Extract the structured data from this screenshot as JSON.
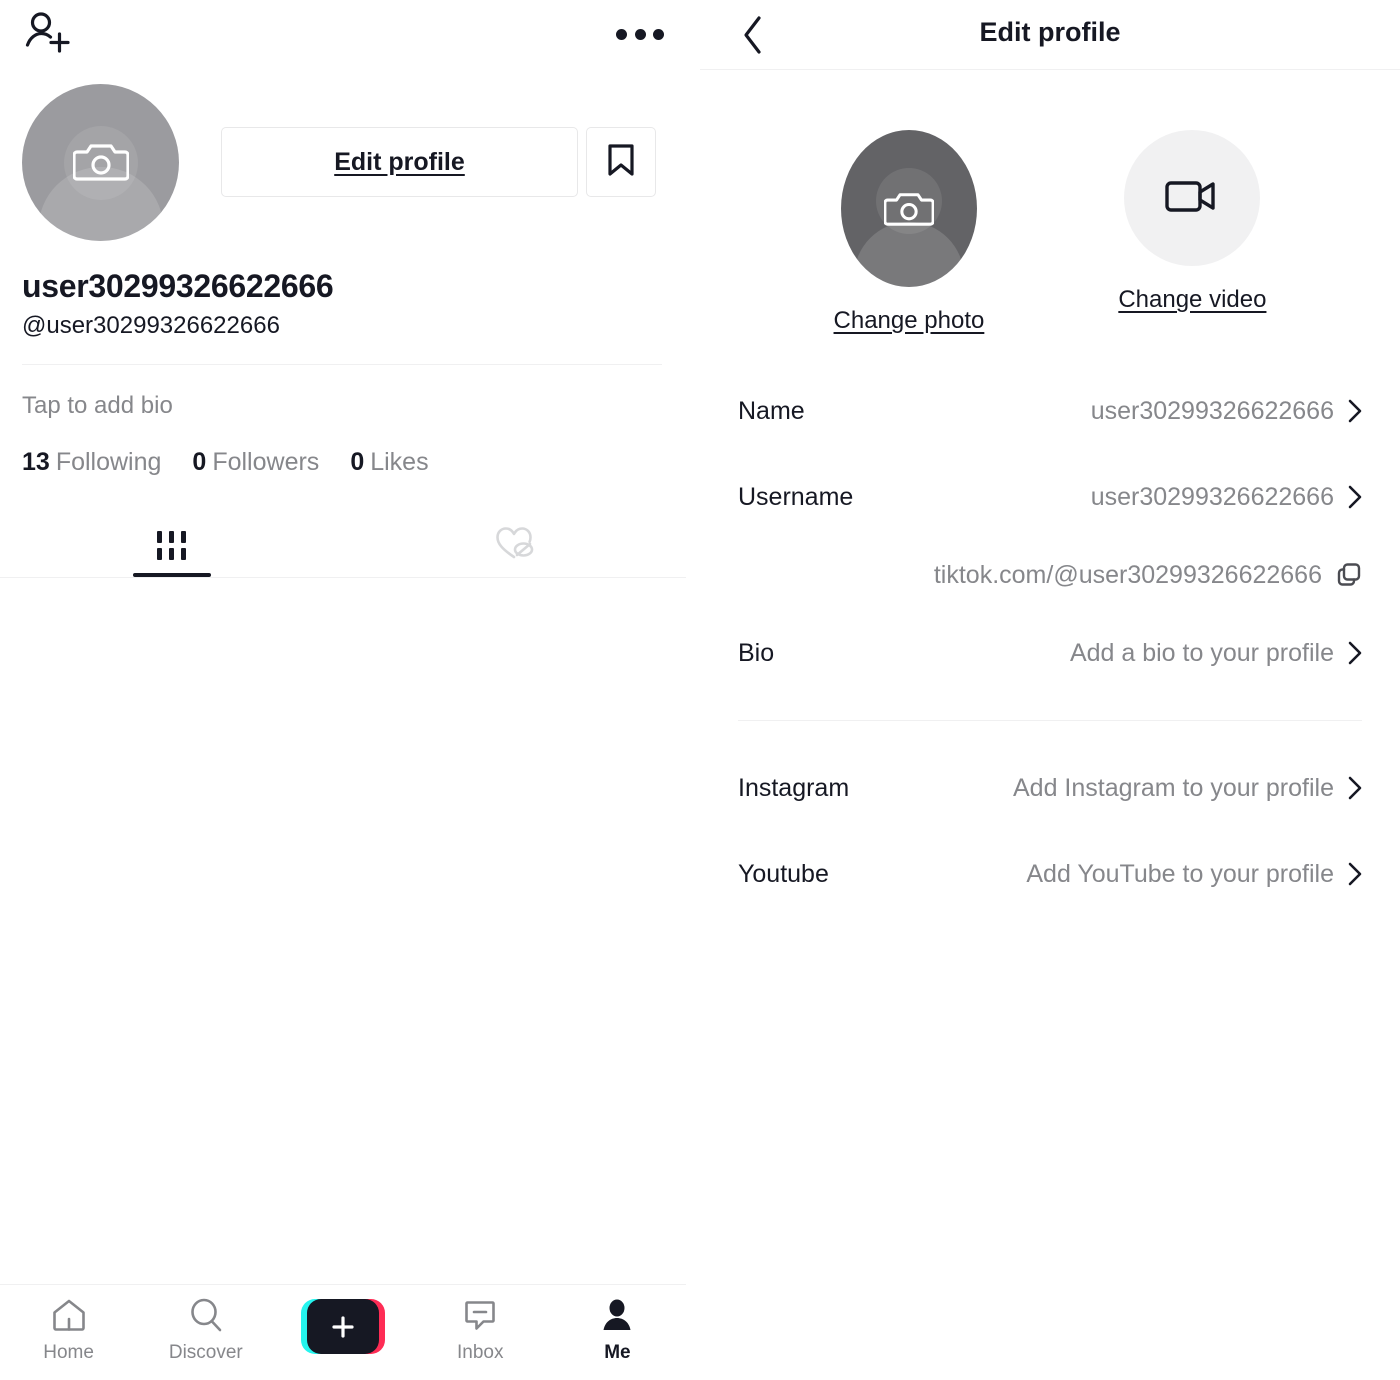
{
  "profile": {
    "topbar": {
      "add_user_icon": "person-add-icon",
      "more_icon": "more-options-icon"
    },
    "avatar_icon": "camera-icon",
    "edit_profile_label": "Edit profile",
    "bookmark_icon": "bookmark-icon",
    "display_name": "user30299326622666",
    "handle": "@user30299326622666",
    "bio_placeholder": "Tap to add bio",
    "stats": [
      {
        "num": "13",
        "label": "Following"
      },
      {
        "num": "0",
        "label": "Followers"
      },
      {
        "num": "0",
        "label": "Likes"
      }
    ],
    "tabs": [
      {
        "icon": "video-grid-icon",
        "active": true
      },
      {
        "icon": "liked-hidden-heart-icon",
        "active": false
      }
    ],
    "bottom_nav": [
      {
        "label": "Home",
        "icon": "home-icon",
        "active": false
      },
      {
        "label": "Discover",
        "icon": "search-icon",
        "active": false
      },
      {
        "label": "",
        "icon": "create-plus-icon",
        "active": false
      },
      {
        "label": "Inbox",
        "icon": "inbox-message-icon",
        "active": false
      },
      {
        "label": "Me",
        "icon": "person-icon",
        "active": true
      }
    ]
  },
  "edit_profile": {
    "back_icon": "back-chevron-icon",
    "title": "Edit profile",
    "media": {
      "photo": {
        "label": "Change photo",
        "icon": "camera-icon"
      },
      "video": {
        "label": "Change video",
        "icon": "video-camera-icon"
      }
    },
    "rows": [
      {
        "label": "Name",
        "value": "user30299326622666"
      },
      {
        "label": "Username",
        "value": "user30299326622666"
      },
      {
        "label": "Bio",
        "value": "Add a bio to your profile"
      },
      {
        "label": "Instagram",
        "value": "Add Instagram to your profile"
      },
      {
        "label": "Youtube",
        "value": "Add YouTube to your profile"
      }
    ],
    "profile_url": "tiktok.com/@user30299326622666",
    "copy_icon": "copy-icon"
  },
  "colors": {
    "text_primary": "#161823",
    "text_secondary": "#86878b",
    "divider": "#f0f0f1",
    "accent_cyan": "#25f4ee",
    "accent_pink": "#fe2c55",
    "avatar_light": "#9b9b9f",
    "avatar_dark": "#636366",
    "circle_light": "#f1f1f2"
  }
}
